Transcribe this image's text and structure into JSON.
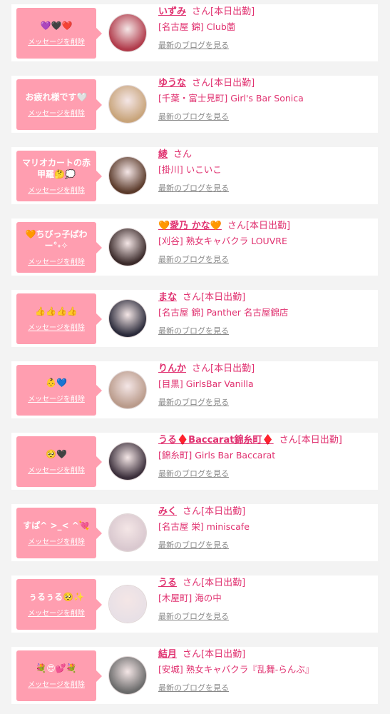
{
  "colors": {
    "accent": "#e0306f",
    "bubble": "#ff9eb0",
    "blog_link": "#888888",
    "background": "#f3f3f3"
  },
  "delete_label": "メッセージを削除",
  "blog_label": "最新のブログを見る",
  "san": "さん",
  "items": [
    {
      "message": "💜🖤❤️",
      "name": "いずみ",
      "status": "[本日出勤]",
      "shop": "[名古屋 錦] Club薗",
      "avatar": "#b03a4a"
    },
    {
      "message": "お疲れ様です🤍",
      "name": "ゆうな",
      "status": "[本日出勤]",
      "shop": "[千葉・富士見町] Girl's Bar Sonica",
      "avatar": "#c8a47a"
    },
    {
      "message": "マリオカートの赤甲羅🤔💭",
      "name": "綾",
      "status": "",
      "shop": "[掛川] いこいこ",
      "avatar": "#5a3a2a"
    },
    {
      "message": "🧡ちびっ子ぱわー°˖✧",
      "name": "🧡愛乃 かな🧡",
      "status": "[本日出勤]",
      "shop": "[刈谷] 熟女キャバクラ LOUVRE",
      "avatar": "#3a2a2a"
    },
    {
      "message": "👍👍👍👍",
      "name": "まな",
      "status": "[本日出勤]",
      "shop": "[名古屋 錦] Panther 名古屋錦店",
      "avatar": "#2a2a3a"
    },
    {
      "message": "👶💙",
      "name": "りんか",
      "status": "[本日出勤]",
      "shop": "[目黒] GirlsBar Vanilla",
      "avatar": "#b99a8a"
    },
    {
      "message": "🥺🖤",
      "name": "うる♦️Baccarat錦糸町♦️",
      "status": "[本日出勤]",
      "shop": "[錦糸町] Girls Bar Baccarat",
      "avatar": "#3a2e3a"
    },
    {
      "message": "すぱ^ >_< ^💘",
      "name": "みく",
      "status": "[本日出勤]",
      "shop": "[名古屋 栄] miniscafe",
      "avatar": "#d9c8cf"
    },
    {
      "message": "ぅるぅる🥺✨",
      "name": "うる",
      "status": "[本日出勤]",
      "shop": "[木屋町] 海の中",
      "avatar": "#e8e0e6"
    },
    {
      "message": "💐😍💕💐",
      "name": "結月",
      "status": "[本日出勤]",
      "shop": "[安城] 熟女キャバクラ『乱舞-らんぶ』",
      "avatar": "#6a6a6a"
    }
  ]
}
